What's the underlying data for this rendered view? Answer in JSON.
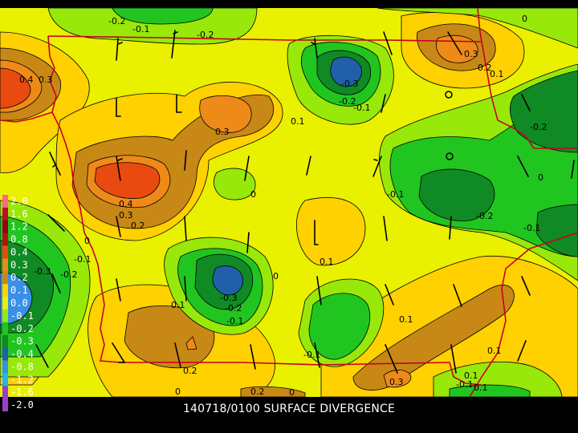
{
  "caption": "140718/0100 SURFACE DIVERGENCE",
  "palette": {
    "bg": "#e9f000",
    "yellow2": "#f3df00",
    "yellow": "#ffd100",
    "ochre": "#c88816",
    "orange": "#ee8a18",
    "redorange": "#e94a0f",
    "lightgreen": "#98e80a",
    "green": "#21c520",
    "darkgreen": "#108a24",
    "blue": "#2160a8",
    "lightblue": "#3a8fe6",
    "border": "#c80020",
    "wind": "#000000"
  },
  "legend": [
    {
      "label": "2.0",
      "color": "#ff6688"
    },
    {
      "label": "1.6",
      "color": "#c01020"
    },
    {
      "label": "1.2",
      "color": "#9a0010"
    },
    {
      "label": "0.8",
      "color": "#b01510"
    },
    {
      "label": "0.4",
      "color": "#e94a0f"
    },
    {
      "label": "0.3",
      "color": "#ee8a18"
    },
    {
      "label": "0.2",
      "color": "#c88816"
    },
    {
      "label": "0.1",
      "color": "#ffd100"
    },
    {
      "label": "0.0",
      "color": "#e9f000"
    },
    {
      "label": "-0.1",
      "color": "#98e80a"
    },
    {
      "label": "-0.2",
      "color": "#21c520"
    },
    {
      "label": "-0.3",
      "color": "#108a24"
    },
    {
      "label": "-0.4",
      "color": "#2160a8"
    },
    {
      "label": "-0.8",
      "color": "#3a8fe6"
    },
    {
      "label": "-1.2",
      "color": "#20b8f0"
    },
    {
      "label": "-1.6",
      "color": "#9a40c8"
    },
    {
      "label": "-2.0",
      "color": "#9a40c8"
    }
  ],
  "contour_labels": [
    {
      "t": "-0.2"
    },
    {
      "t": "-0.1"
    },
    {
      "t": "-0.2"
    },
    {
      "t": "0"
    },
    {
      "t": "0.4"
    },
    {
      "t": "0.3"
    },
    {
      "t": "0.3"
    },
    {
      "t": "0.3"
    },
    {
      "t": "0.2"
    },
    {
      "t": "0.1"
    },
    {
      "t": "-0.3"
    },
    {
      "t": "-0.2"
    },
    {
      "t": "-0.1"
    },
    {
      "t": "0.1"
    },
    {
      "t": "-0.2"
    },
    {
      "t": "0"
    },
    {
      "t": "0.4"
    },
    {
      "t": "0.3"
    },
    {
      "t": "0.2"
    },
    {
      "t": "0"
    },
    {
      "t": "-0.1"
    },
    {
      "t": "-0.2"
    },
    {
      "t": "-0.1"
    },
    {
      "t": "0.1"
    },
    {
      "t": "0"
    },
    {
      "t": "-0.3"
    },
    {
      "t": "-0.2"
    },
    {
      "t": "-0.1"
    },
    {
      "t": "0"
    },
    {
      "t": "-0.1"
    },
    {
      "t": "-0.3"
    },
    {
      "t": "-0.2"
    },
    {
      "t": "0.1"
    },
    {
      "t": "0"
    },
    {
      "t": "0.2"
    },
    {
      "t": "0.1"
    },
    {
      "t": "-0.1"
    },
    {
      "t": "0.1"
    },
    {
      "t": "0.3"
    },
    {
      "t": "0.1"
    },
    {
      "t": "-0.1"
    },
    {
      "t": "0.2"
    },
    {
      "t": "0.1"
    },
    {
      "t": "0"
    }
  ]
}
